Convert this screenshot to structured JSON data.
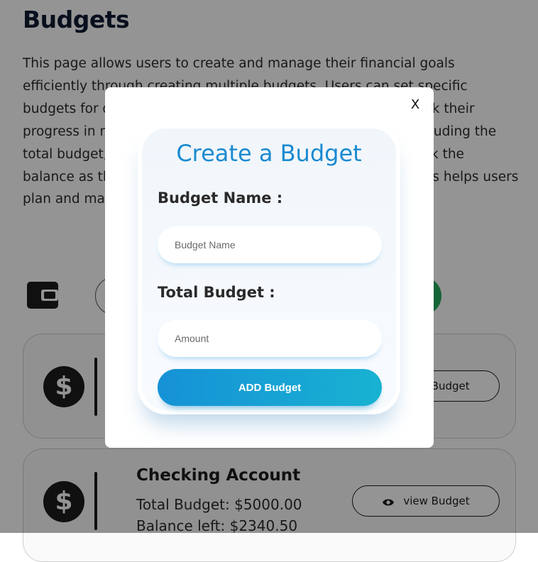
{
  "page": {
    "title": "Budgets",
    "description": "This page allows users to create and manage their financial goals efficiently through creating multiple budgets. Users can set specific budgets for different categories, view their spending, and track their progress in real time. Each budget card shows key details, including the total budget, and the balance left. Additionally, users can track the balance as they spend, and see how their finances evolve. This helps users plan and manage their budgets effectively."
  },
  "toolbar": {
    "wallet_icon": "wallet-icon",
    "create_button_color": "#27ae60"
  },
  "accounts": [
    {
      "name": "",
      "total": "",
      "balance": "",
      "view_label": "view Budget"
    },
    {
      "name": "Checking Account",
      "total": "Total Budget: $5000.00",
      "balance": "Balance left: $2340.50",
      "view_label": "view Budget"
    }
  ],
  "modal": {
    "close_label": "X",
    "title": "Create a Budget",
    "name_label": "Budget Name :",
    "name_placeholder": "Budget Name",
    "total_label": "Total Budget :",
    "total_placeholder": "Amount",
    "submit_label": "ADD Budget",
    "title_color": "#1a8ad0",
    "button_gradient": [
      "#1692d6",
      "#18b2d2"
    ]
  }
}
